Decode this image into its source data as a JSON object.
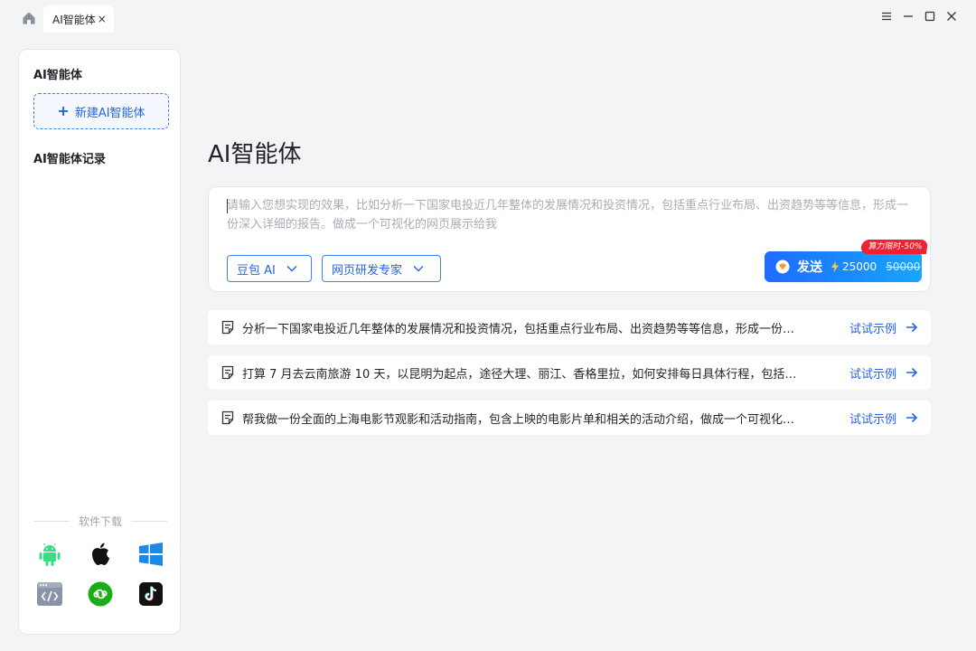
{
  "titlebar": {
    "tab_label": "AI智能体",
    "tab_close": "×"
  },
  "sidebar": {
    "title": "AI智能体",
    "new_agent_label": "新建AI智能体",
    "history_title": "AI智能体记录",
    "download_label": "软件下载",
    "apps": [
      "android-icon",
      "apple-icon",
      "windows-icon",
      "web-icon",
      "mini-program-icon",
      "tiktok-icon"
    ]
  },
  "main": {
    "title": "AI智能体",
    "prompt_placeholder": "请输入您想实现的效果，比如分析一下国家电投近几年整体的发展情况和投资情况，包括重点行业布局、出资趋势等等信息，形成一份深入详细的报告。做成一个可视化的网页展示给我",
    "model_select": "豆包 AI",
    "expert_select": "网页研发专家",
    "send_label": "发送",
    "send_price": "25000",
    "send_original_price": "50000",
    "promo_badge": "算力限时-50%",
    "examples": [
      {
        "text": "分析一下国家电投近几年整体的发展情况和投资情况，包括重点行业布局、出资趋势等等信息，形成一份…",
        "action": "试试示例"
      },
      {
        "text": "打算 7 月去云南旅游 10 天，以昆明为起点，途径大理、丽江、香格里拉，如何安排每日具体行程，包括…",
        "action": "试试示例"
      },
      {
        "text": "帮我做一份全面的上海电影节观影和活动指南，包含上映的电影片单和相关的活动介绍，做成一个可视化…",
        "action": "试试示例"
      }
    ]
  },
  "colors": {
    "accent": "#2563eb",
    "promo": "#ee2233"
  }
}
